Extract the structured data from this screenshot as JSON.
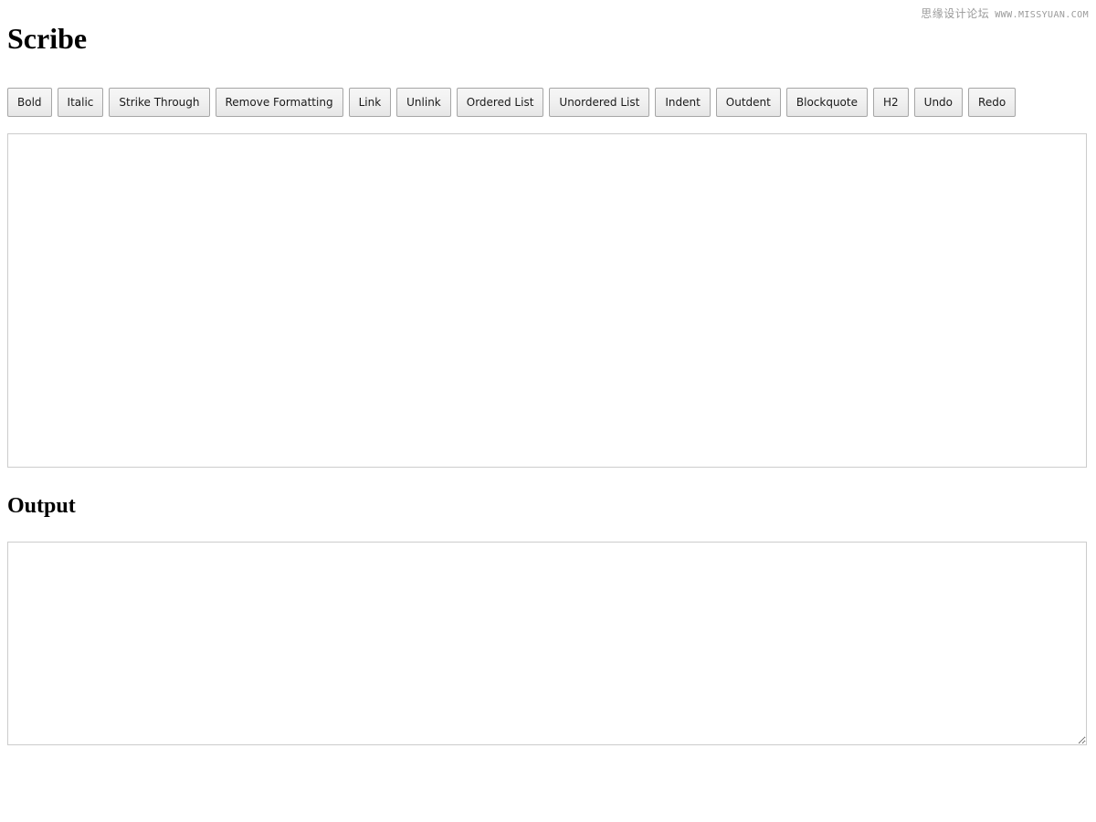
{
  "watermark": {
    "cn_text": "思缘设计论坛",
    "en_text": "WWW.MISSYUAN.COM",
    "color": "#9a9a9a"
  },
  "header": {
    "title": "Scribe"
  },
  "toolbar": {
    "buttons": [
      {
        "label": "Bold",
        "name": "bold"
      },
      {
        "label": "Italic",
        "name": "italic"
      },
      {
        "label": "Strike Through",
        "name": "strike-through"
      },
      {
        "label": "Remove Formatting",
        "name": "remove-formatting"
      },
      {
        "label": "Link",
        "name": "link"
      },
      {
        "label": "Unlink",
        "name": "unlink"
      },
      {
        "label": "Ordered List",
        "name": "ordered-list"
      },
      {
        "label": "Unordered List",
        "name": "unordered-list"
      },
      {
        "label": "Indent",
        "name": "indent"
      },
      {
        "label": "Outdent",
        "name": "outdent"
      },
      {
        "label": "Blockquote",
        "name": "blockquote"
      },
      {
        "label": "H2",
        "name": "h2"
      },
      {
        "label": "Undo",
        "name": "undo"
      },
      {
        "label": "Redo",
        "name": "redo"
      }
    ]
  },
  "editor": {
    "value": "",
    "placeholder": ""
  },
  "output": {
    "heading": "Output",
    "value": "",
    "placeholder": ""
  },
  "colors": {
    "button_border": "#a6a6a6",
    "button_face": "#f1f1f1",
    "field_border": "#cccccc",
    "text": "#000000"
  }
}
